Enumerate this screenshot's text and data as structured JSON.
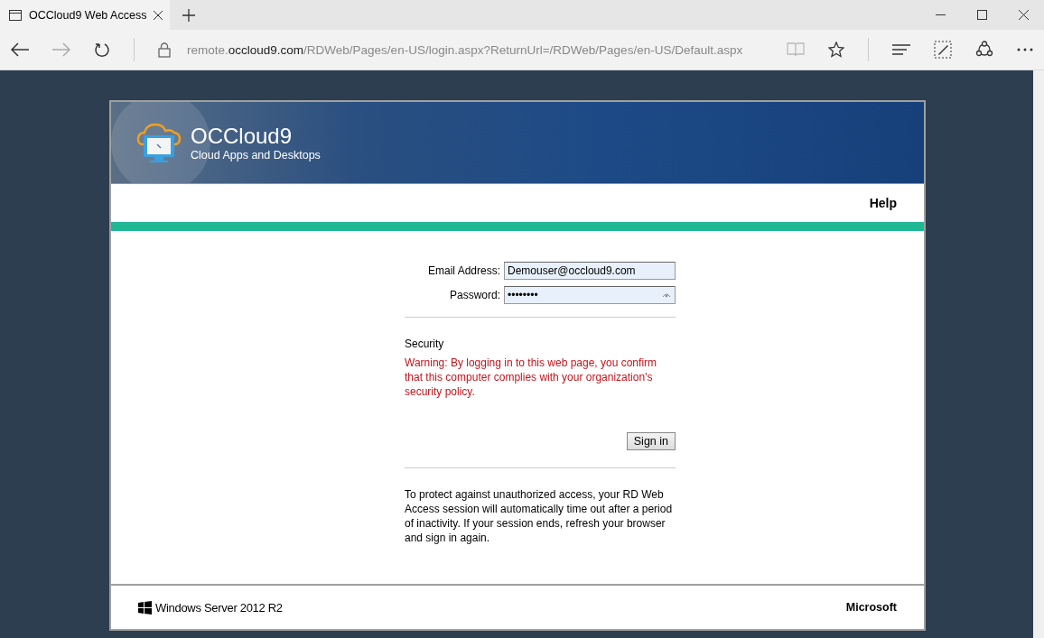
{
  "browser": {
    "tab_title": "OCCloud9 Web Access",
    "url": {
      "prefix": "remote.",
      "domain": "occloud9.com",
      "path": "/RDWeb/Pages/en-US/login.aspx?ReturnUrl=/RDWeb/Pages/en-US/Default.aspx"
    }
  },
  "header": {
    "title": "OCCloud9",
    "subtitle": "Cloud Apps and Desktops"
  },
  "help_link": "Help",
  "form": {
    "fields": [
      {
        "label": "Email Address:",
        "value": "Demouser@occloud9.com",
        "kind": "text"
      },
      {
        "label": "Password:",
        "value": "••••••••",
        "kind": "password"
      }
    ],
    "security_heading": "Security",
    "warning": "Warning: By logging in to this web page, you confirm that this computer complies with your organization's security policy.",
    "sign_in": "Sign in",
    "note": "To protect against unauthorized access, your RD Web Access session will automatically time out after a period of inactivity. If your session ends, refresh your browser and sign in again."
  },
  "footer": {
    "product": "Windows Server 2012 R2",
    "vendor": "Microsoft"
  }
}
